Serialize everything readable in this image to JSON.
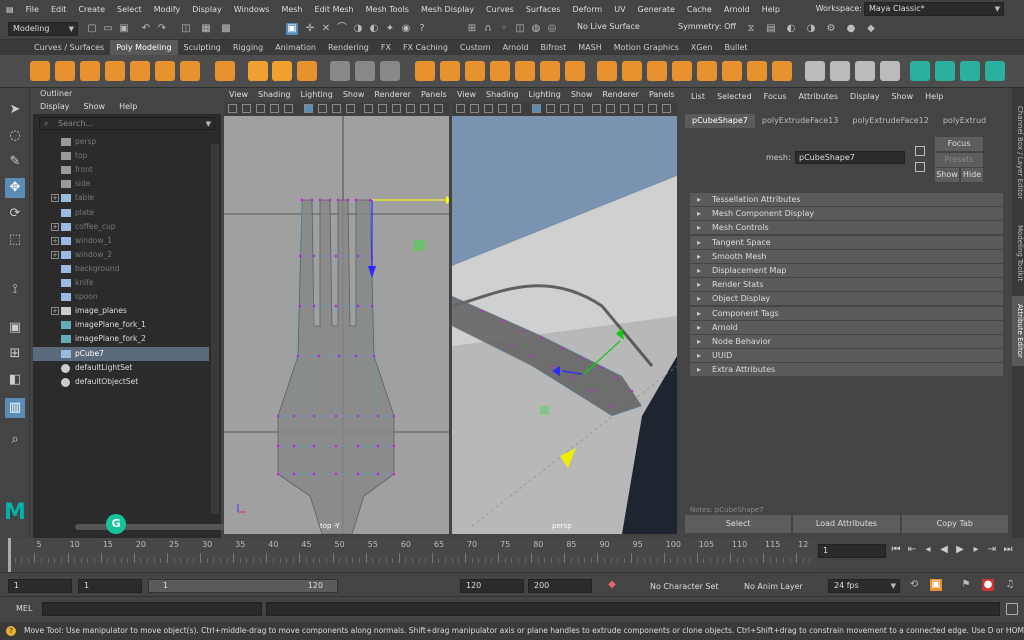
{
  "menubar": {
    "items": [
      "File",
      "Edit",
      "Create",
      "Select",
      "Modify",
      "Display",
      "Windows",
      "Mesh",
      "Edit Mesh",
      "Mesh Tools",
      "Mesh Display",
      "Curves",
      "Surfaces",
      "Deform",
      "UV",
      "Generate",
      "Cache",
      "Arnold",
      "Help"
    ],
    "workspace_label": "Workspace:",
    "workspace_value": "Maya Classic*"
  },
  "statusline": {
    "mode": "Modeling",
    "live_surface": "No Live Surface",
    "symmetry": "Symmetry: Off"
  },
  "shelf_tabs": [
    "Curves / Surfaces",
    "Poly Modeling",
    "Sculpting",
    "Rigging",
    "Animation",
    "Rendering",
    "FX",
    "FX Caching",
    "Custom",
    "Arnold",
    "Bifrost",
    "MASH",
    "Motion Graphics",
    "XGen",
    "Bullet"
  ],
  "shelf_active": "Poly Modeling",
  "outliner": {
    "title": "Outliner",
    "menu": [
      "Display",
      "Show",
      "Help"
    ],
    "search_placeholder": "Search...",
    "items": [
      {
        "label": "persp",
        "dim": true,
        "expander": false,
        "icon": "camera-icon"
      },
      {
        "label": "top",
        "dim": true,
        "expander": false,
        "icon": "camera-icon"
      },
      {
        "label": "front",
        "dim": true,
        "expander": false,
        "icon": "camera-icon"
      },
      {
        "label": "side",
        "dim": true,
        "expander": false,
        "icon": "camera-icon"
      },
      {
        "label": "table",
        "dim": true,
        "expander": true,
        "icon": "mesh-icon"
      },
      {
        "label": "plate",
        "dim": true,
        "expander": false,
        "icon": "mesh-icon"
      },
      {
        "label": "coffee_cup",
        "dim": true,
        "expander": true,
        "icon": "mesh-icon"
      },
      {
        "label": "window_1",
        "dim": true,
        "expander": true,
        "icon": "mesh-icon"
      },
      {
        "label": "window_2",
        "dim": true,
        "expander": true,
        "icon": "mesh-icon"
      },
      {
        "label": "background",
        "dim": true,
        "expander": false,
        "icon": "mesh-icon"
      },
      {
        "label": "knife",
        "dim": true,
        "expander": false,
        "icon": "mesh-icon"
      },
      {
        "label": "spoon",
        "dim": true,
        "expander": false,
        "icon": "mesh-icon"
      },
      {
        "label": "image_planes",
        "dim": false,
        "expander": true,
        "icon": "group-icon"
      },
      {
        "label": "imagePlane_fork_1",
        "dim": false,
        "expander": false,
        "icon": "imageplane-icon"
      },
      {
        "label": "imagePlane_fork_2",
        "dim": false,
        "expander": false,
        "icon": "imageplane-icon"
      },
      {
        "label": "pCube7",
        "dim": false,
        "expander": false,
        "icon": "mesh-icon",
        "selected": true
      },
      {
        "label": "defaultLightSet",
        "dim": false,
        "expander": false,
        "icon": "set-icon"
      },
      {
        "label": "defaultObjectSet",
        "dim": false,
        "expander": false,
        "icon": "set-icon"
      }
    ]
  },
  "viewport_menu": [
    "View",
    "Shading",
    "Lighting",
    "Show",
    "Renderer",
    "Panels"
  ],
  "viewport_left": {
    "camera": "top -Y"
  },
  "viewport_right": {
    "camera": "persp"
  },
  "attribute_editor": {
    "menu": [
      "List",
      "Selected",
      "Focus",
      "Attributes",
      "Display",
      "Show",
      "Help"
    ],
    "tabs": [
      "pCubeShape7",
      "polyExtrudeFace13",
      "polyExtrudeFace12",
      "polyExtrud"
    ],
    "mesh_label": "mesh:",
    "mesh_value": "pCubeShape7",
    "focus_btn": "Focus",
    "presets_btn": "Presets",
    "show_btn": "Show",
    "hide_btn": "Hide",
    "sections": [
      "Tessellation Attributes",
      "Mesh Component Display",
      "Mesh Controls",
      "Tangent Space",
      "Smooth Mesh",
      "Displacement Map",
      "Render Stats",
      "Object Display",
      "Component Tags",
      "Arnold",
      "Node Behavior",
      "UUID",
      "Extra Attributes"
    ],
    "notes": "Notes: pCubeShape7",
    "select_btn": "Select",
    "load_btn": "Load Attributes",
    "copy_btn": "Copy Tab"
  },
  "right_tabs": [
    "Channel Box / Layer Editor",
    "Modeling Toolkit",
    "Attribute Editor"
  ],
  "timeline": {
    "ticks": [
      5,
      10,
      15,
      20,
      25,
      30,
      35,
      40,
      45,
      50,
      55,
      60,
      65,
      70,
      75,
      80,
      85,
      90,
      95,
      100,
      105,
      110,
      115,
      12
    ],
    "current_frame": "1"
  },
  "range": {
    "start": "1",
    "playback_start": "1",
    "slider_start": "1",
    "slider_end": "120",
    "playback_end": "120",
    "end": "200",
    "character_set": "No Character Set",
    "anim_layer": "No Anim Layer",
    "fps": "24 fps"
  },
  "command": {
    "label": "MEL"
  },
  "help_line": "Move Tool: Use manipulator to move object(s). Ctrl+middle-drag to move components along normals. Shift+drag manipulator axis or plane handles to extrude components or clone objects. Ctrl+Shift+drag to constrain movement to a connected edge. Use D or HOME to change the pivot",
  "colors": {
    "accent": "#5b8cb5",
    "selection": "#5b6a7a",
    "maya_logo": "#00b2a9"
  }
}
